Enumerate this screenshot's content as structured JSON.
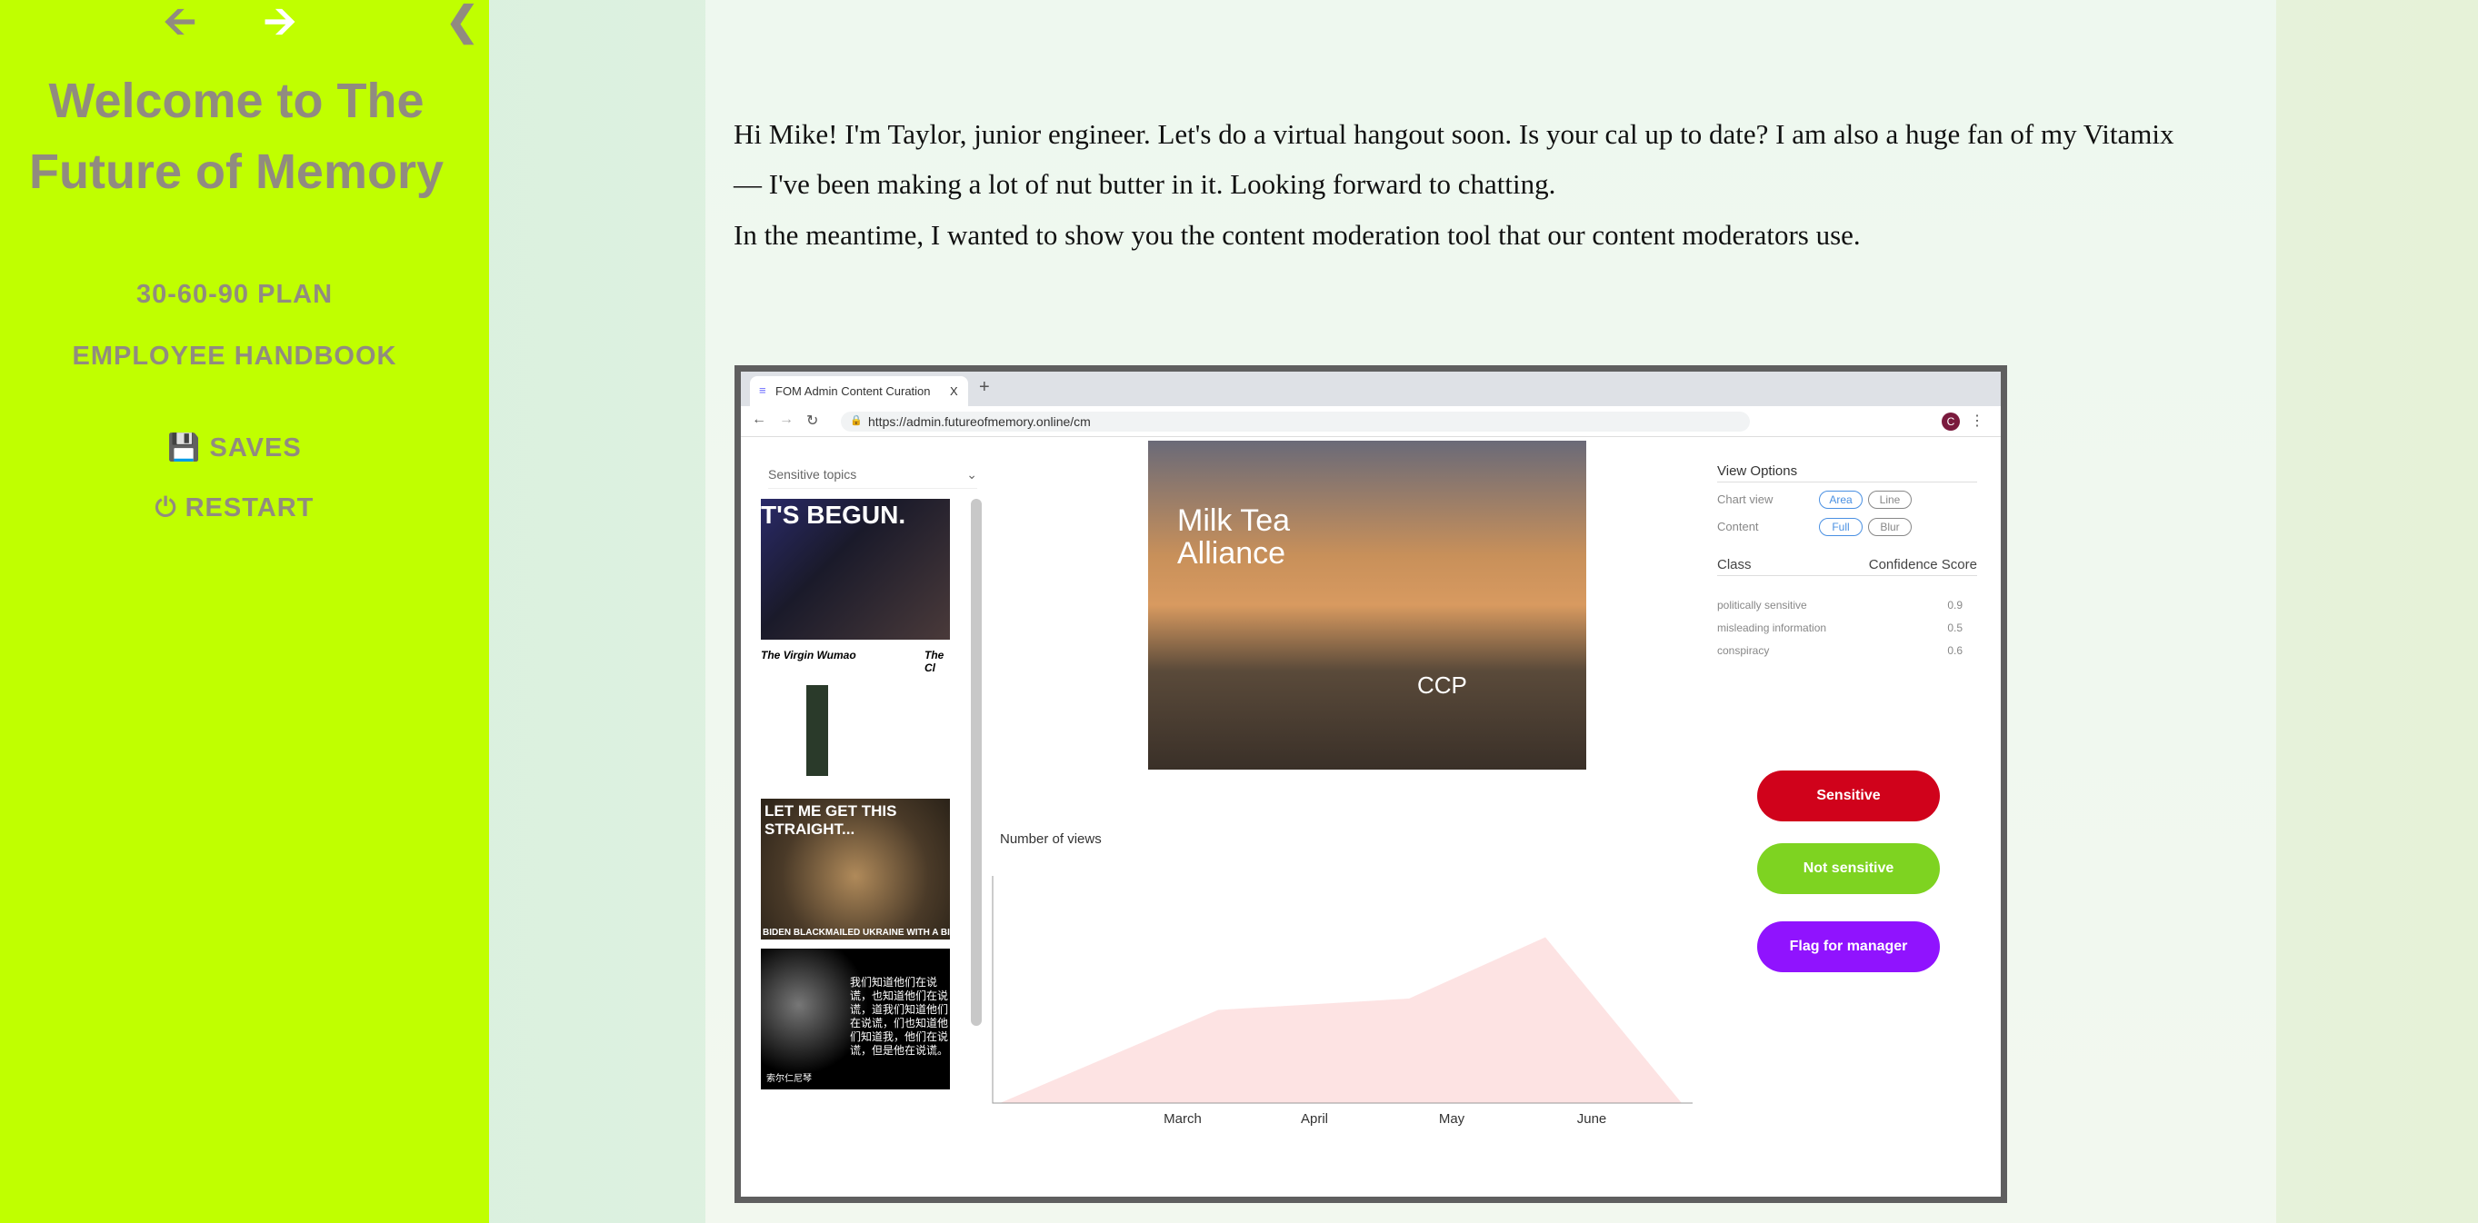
{
  "sidebar": {
    "back_icon": "arrow-left-icon",
    "forward_icon": "arrow-right-icon",
    "collapse_icon": "chevron-left-icon",
    "title_line1": "Welcome to The",
    "title_line2": "Future of Memory",
    "links": [
      "30-60-90 PLAN",
      "EMPLOYEE HANDBOOK"
    ],
    "saves": "SAVES",
    "restart": "RESTART",
    "bg_color": "#c0ff00",
    "text_color": "#918b80"
  },
  "message": {
    "line1": "Hi Mike! I'm Taylor, junior engineer. Let's do a virtual hangout soon. Is your cal up to date? I am also a huge fan of my Vitamix",
    "line2": "— I've been making a lot of nut butter in it. Looking forward to chatting.",
    "line3": "In the meantime, I wanted to show you the content moderation tool that our content moderators use."
  },
  "browser": {
    "tab_title": "FOM Admin Content Curation",
    "tab_close": "X",
    "new_tab": "+",
    "url": "https://admin.futureofmemory.online/cm",
    "profile_initial": "C"
  },
  "tool": {
    "topic_select": "Sensitive topics",
    "thumbnails": [
      {
        "text_top": "T'S BEGUN."
      },
      {
        "text_top": "The Virgin Wumao",
        "text_right": "The Cl"
      },
      {
        "text_top": "LET ME GET THIS STRAIGHT...",
        "text_bottom": "BIDEN BLACKMAILED UKRAINE WITH A BILLION"
      },
      {
        "text_right": "我们知道他们在说谎，也知道他们在说谎，道我们知道他们在说谎，们也知道他们知道我，他们在说谎，但是他在说谎。",
        "text_bottom": "索尔仁尼琴"
      }
    ],
    "main_image": {
      "text1": "Milk Tea",
      "text2": "Alliance",
      "text3": "CCP"
    },
    "view_options": {
      "title": "View Options",
      "chart_view_label": "Chart view",
      "chart_options": [
        "Area",
        "Line"
      ],
      "chart_selected": "Area",
      "content_label": "Content",
      "content_options": [
        "Full",
        "Blur"
      ],
      "content_selected": "Full"
    },
    "classes": {
      "header_class": "Class",
      "header_score": "Confidence Score",
      "rows": [
        {
          "name": "politically sensitive",
          "score": "0.9"
        },
        {
          "name": "misleading information",
          "score": "0.5"
        },
        {
          "name": "conspiracy",
          "score": "0.6"
        }
      ]
    },
    "buttons": {
      "sensitive": "Sensitive",
      "not_sensitive": "Not sensitive",
      "flag": "Flag for manager"
    },
    "colors": {
      "sensitive": "#d0021b",
      "not_sensitive": "#7ed321",
      "flag": "#9013fe",
      "area": "#fde3e3",
      "accent": "#4a90e2"
    }
  },
  "chart_data": {
    "type": "area",
    "ylabel": "Number of views",
    "categories": [
      "March",
      "April",
      "May",
      "June"
    ],
    "x_positions": [
      0,
      1,
      2,
      3,
      4,
      5
    ],
    "values_relative": [
      0,
      0.41,
      0.46,
      0.73,
      0
    ],
    "note_values": "no y-axis ticks printed; heights relative to max axis height"
  }
}
